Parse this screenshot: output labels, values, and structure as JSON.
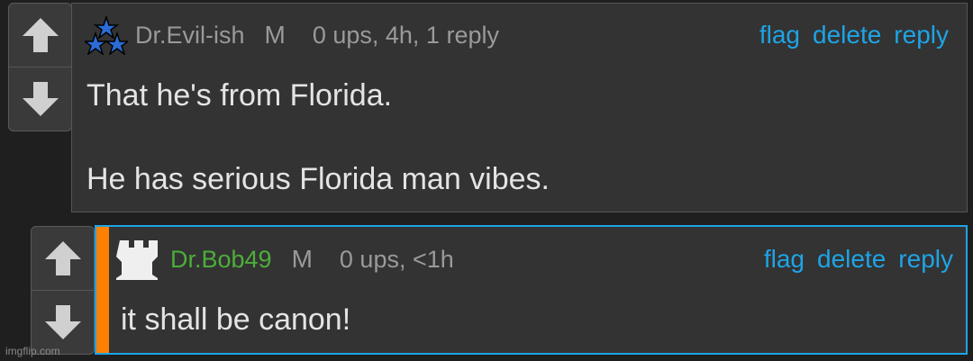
{
  "comments": [
    {
      "username": "Dr.Evil-ish",
      "mod_badge": "M",
      "meta": "0 ups, 4h, 1 reply",
      "actions": {
        "flag": "flag",
        "delete": "delete",
        "reply": "reply"
      },
      "body_line1": "That he's from Florida.",
      "body_line2": "He has serious Florida man vibes.",
      "avatar_icon": "three-stars-icon"
    },
    {
      "username": "Dr.Bob49",
      "mod_badge": "M",
      "meta": "0 ups, <1h",
      "actions": {
        "flag": "flag",
        "delete": "delete",
        "reply": "reply"
      },
      "body_line1": "it shall be canon!",
      "avatar_icon": "castle-tower-icon",
      "username_color": "#4cae3a",
      "highlight_color": "#ff7f00",
      "border_color": "#1ea4e6"
    }
  ],
  "watermark": "imgflip.com",
  "colors": {
    "link": "#1ea4e6",
    "text": "#e4e4e4",
    "meta": "#9a9a9a"
  }
}
